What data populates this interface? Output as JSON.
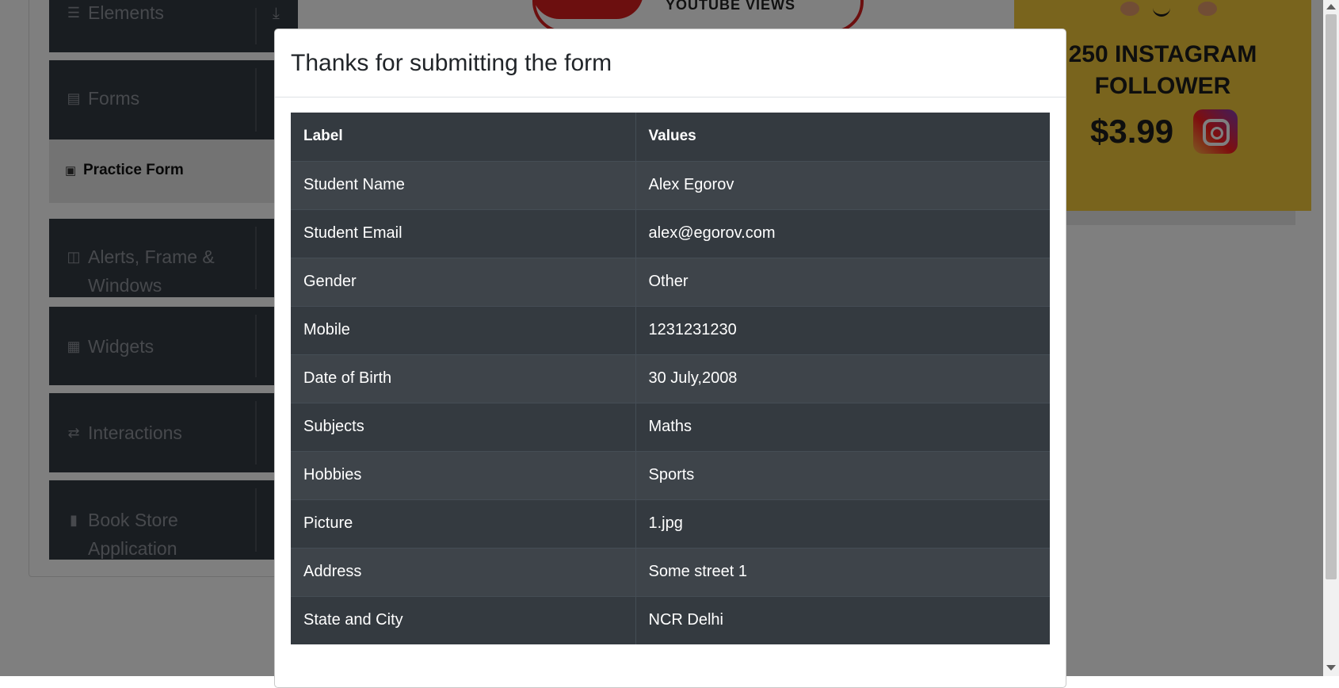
{
  "sidebar": {
    "groups": [
      {
        "label": "Elements",
        "icon": "menu-icon"
      },
      {
        "label": "Forms",
        "icon": "document-icon"
      },
      {
        "label": "Alerts, Frame &",
        "label2": "Windows",
        "icon": "window-icon"
      },
      {
        "label": "Widgets",
        "icon": "widgets-icon"
      },
      {
        "label": "Interactions",
        "icon": "interactions-icon"
      },
      {
        "label": "Book Store",
        "label2": "Application",
        "icon": "books-icon"
      }
    ],
    "active_item": {
      "label": "Practice Form",
      "icon": "html5-icon"
    }
  },
  "ads": {
    "top_banner_text": "YOUTUBE VIEWS",
    "right_line1": "250 INSTAGRAM",
    "right_line2": "FOLLOWER",
    "right_price": "$3.99"
  },
  "modal": {
    "title": "Thanks for submitting the form",
    "table": {
      "headers": [
        "Label",
        "Values"
      ],
      "rows": [
        [
          "Student Name",
          "Alex Egorov"
        ],
        [
          "Student Email",
          "alex@egorov.com"
        ],
        [
          "Gender",
          "Other"
        ],
        [
          "Mobile",
          "1231231230"
        ],
        [
          "Date of Birth",
          "30 July,2008"
        ],
        [
          "Subjects",
          "Maths"
        ],
        [
          "Hobbies",
          "Sports"
        ],
        [
          "Picture",
          "1.jpg"
        ],
        [
          "Address",
          "Some street 1"
        ],
        [
          "State and City",
          "NCR Delhi"
        ]
      ]
    }
  },
  "colors": {
    "table_header": "#343a40",
    "table_row_odd": "#3e444a",
    "overlay": "rgba(0,0,0,0.5)",
    "ad_background": "#f2c83b"
  }
}
